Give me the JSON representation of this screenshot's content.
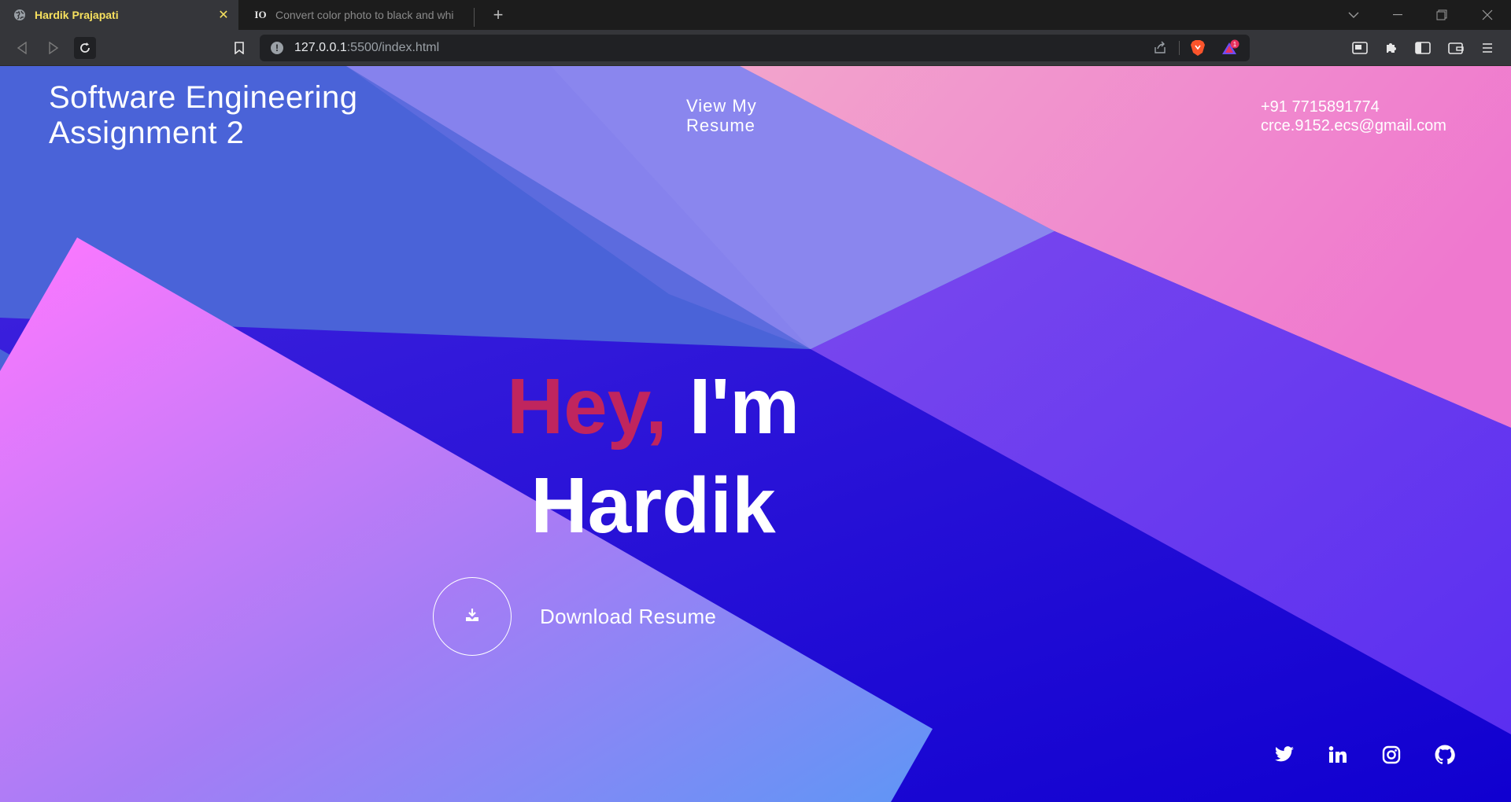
{
  "browser": {
    "tabs": [
      {
        "title": "Hardik Prajapati",
        "active": true
      },
      {
        "title": "Convert color photo to black and whi",
        "active": false
      }
    ],
    "url": {
      "host": "127.0.0.1",
      "path": ":5500/index.html"
    },
    "shield_badge": "1"
  },
  "page": {
    "site_title": "Software Engineering\nAssignment 2",
    "nav_resume": "View My Resume",
    "contact": {
      "phone": "+91 7715891774",
      "email": "crce.9152.ecs@gmail.com"
    },
    "hero": {
      "greeting": "Hey,",
      "intro": "I'm",
      "name": "Hardik"
    },
    "download_label": "Download Resume",
    "socials": [
      "twitter-icon",
      "linkedin-icon",
      "instagram-icon",
      "github-icon"
    ]
  },
  "colors": {
    "accent": "#c0255e",
    "bg_blue": "#4a63d8",
    "bg_deep": "#1a00d4",
    "bg_pink": "#f08ac8"
  }
}
